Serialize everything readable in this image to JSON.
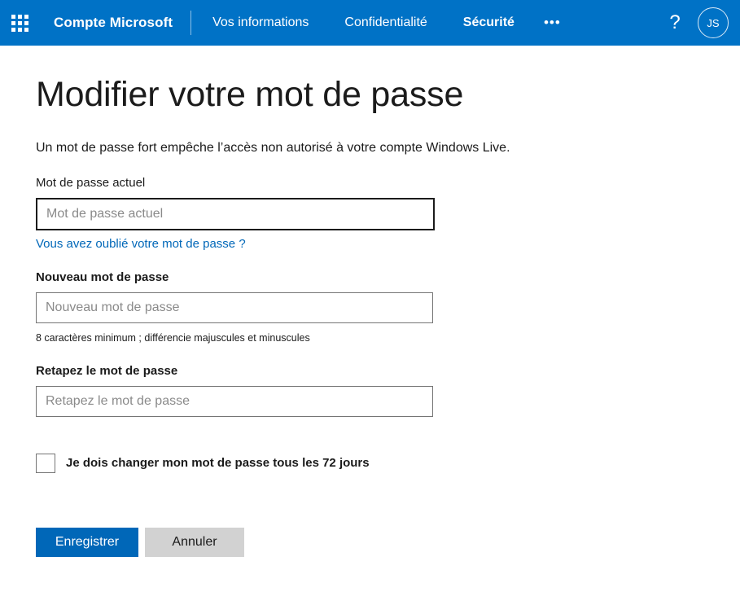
{
  "header": {
    "waffle_icon": "app-launcher-waffle-icon",
    "brand": "Compte Microsoft",
    "nav": [
      {
        "label": "Vos informations",
        "active": false
      },
      {
        "label": "Confidentialité",
        "active": false
      },
      {
        "label": "Sécurité",
        "active": true
      }
    ],
    "more_label": "•••",
    "help_label": "?",
    "avatar_initials": "JS",
    "background_color": "#0072c6"
  },
  "main": {
    "title": "Modifier votre mot de passe",
    "intro": "Un mot de passe fort empêche l’accès non autorisé à votre compte Windows Live.",
    "current_password": {
      "label": "Mot de passe actuel",
      "placeholder": "Mot de passe actuel",
      "value": "",
      "focused": true
    },
    "forgot_link": "Vous avez oublié votre mot de passe ?",
    "new_password": {
      "label": "Nouveau mot de passe",
      "placeholder": "Nouveau mot de passe",
      "value": "",
      "hint": "8 caractères minimum ; différencie majuscules et minuscules"
    },
    "retype_password": {
      "label": "Retapez le mot de passe",
      "placeholder": "Retapez le mot de passe",
      "value": ""
    },
    "expiry_checkbox": {
      "label": "Je dois changer mon mot de passe tous les 72 jours",
      "checked": false
    },
    "buttons": {
      "save": "Enregistrer",
      "cancel": "Annuler"
    }
  },
  "colors": {
    "header_blue": "#0072c6",
    "primary_button_blue": "#0067b8",
    "link_blue": "#0067b8",
    "secondary_button_gray": "#d2d2d2"
  }
}
